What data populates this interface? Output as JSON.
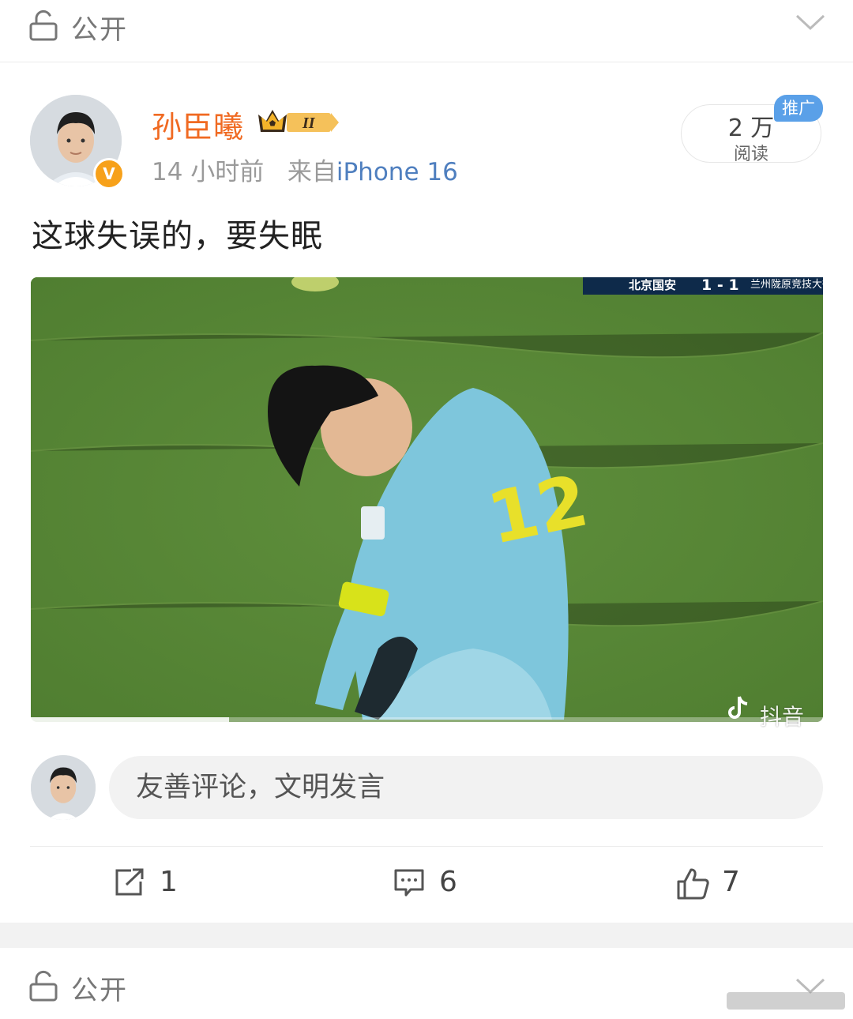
{
  "top_bar": {
    "privacy_label": "公开",
    "lock_icon": "lock-icon",
    "dropdown_icon": "chevron-down-icon"
  },
  "post": {
    "username": "孙臣曦",
    "username_color": "#f06a22",
    "vip_badge": "crown-level-badge",
    "timestamp": "14 小时前",
    "source_prefix": "来自",
    "device": "iPhone 16",
    "read_count": "2 万",
    "read_unit": "阅读",
    "promo_tag": "推广",
    "text": "这球失误的，要失眠"
  },
  "media": {
    "scoreboard_team": "北京国安",
    "scoreboard_score": "1 - 1",
    "scoreboard_opponent": "兰州陇原竞技大街",
    "watermark": "抖音",
    "playback_progress": 0.25
  },
  "comment": {
    "placeholder": "友善评论，文明发言"
  },
  "actions": {
    "share_count": "1",
    "comment_count": "6",
    "like_count": "7"
  },
  "next_post": {
    "privacy_label": "公开"
  },
  "colors": {
    "accent_orange": "#f06a22",
    "link_blue": "#4f7fbf",
    "promo_blue": "#5aa0e8"
  }
}
